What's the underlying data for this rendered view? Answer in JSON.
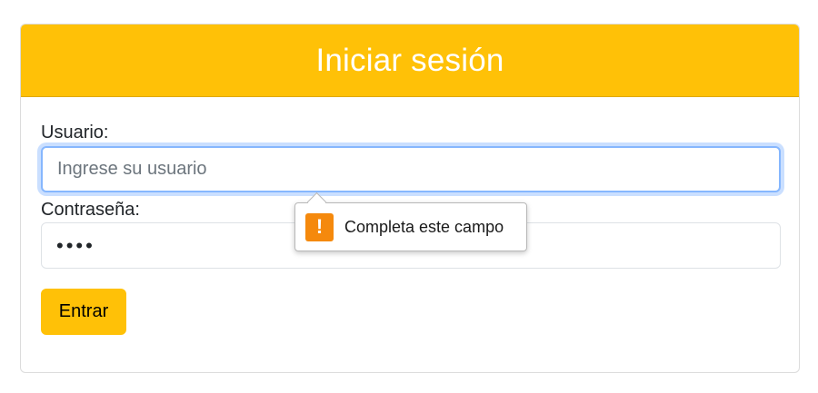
{
  "header": {
    "title": "Iniciar sesión"
  },
  "form": {
    "username": {
      "label": "Usuario:",
      "placeholder": "Ingrese su usuario",
      "value": ""
    },
    "password": {
      "label": "Contraseña:",
      "value": "••••"
    },
    "submit_label": "Entrar"
  },
  "validation_tooltip": {
    "icon": "warning-icon",
    "message": "Completa este campo"
  },
  "colors": {
    "accent": "#ffc107",
    "focus_ring": "#86b7fe",
    "warning": "#f5890d"
  }
}
